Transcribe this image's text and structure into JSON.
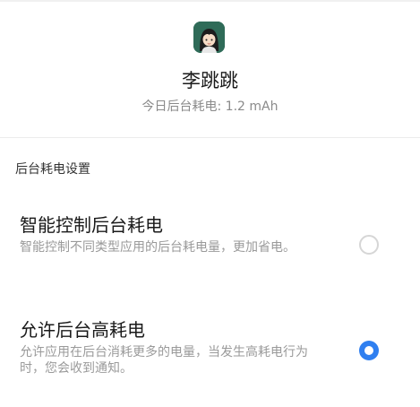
{
  "app": {
    "icon": "girl-avatar-icon",
    "name": "李跳跳",
    "usage": "今日后台耗电: 1.2 mAh"
  },
  "settings": {
    "section_title": "后台耗电设置",
    "options": [
      {
        "title": "智能控制后台耗电",
        "description": "智能控制不同类型应用的后台耗电量，更加省电。",
        "selected": false
      },
      {
        "title": "允许后台高耗电",
        "description": "允许应用在后台消耗更多的电量，当发生高耗电行为时，您会收到通知。",
        "selected": true
      }
    ]
  },
  "colors": {
    "accent": "#2f7ff0",
    "app_icon_bg": "#2f6b58"
  }
}
